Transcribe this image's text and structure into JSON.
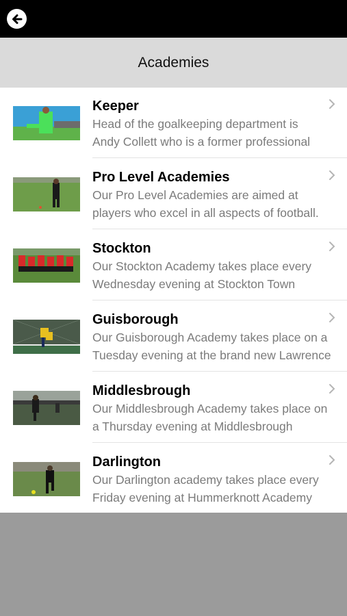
{
  "header": {
    "back_icon": "arrow-left-circle-icon",
    "title": "Academies"
  },
  "colors": {
    "topbar": "#000000",
    "titlebar": "#dadada",
    "list_bg": "#ffffff",
    "footer_bg": "#9b9b9b",
    "desc_text": "#7b7b7b"
  },
  "academies": [
    {
      "name": "Keeper",
      "line1": "Head of the goalkeeping department is",
      "line2": "Andy Collett who is a former professional",
      "thumb": "photo-goalkeeper-green-kit",
      "chevron_icon": "chevron-right-icon"
    },
    {
      "name": "Pro Level Academies",
      "line1": "Our Pro Level Academies are aimed at",
      "line2": "players who excel in all aspects of football.",
      "thumb": "photo-player-on-pitch",
      "chevron_icon": "chevron-right-icon"
    },
    {
      "name": "Stockton",
      "line1": "Our Stockton Academy takes place every",
      "line2": "Wednesday evening at Stockton Town",
      "thumb": "photo-team-red-kits",
      "chevron_icon": "chevron-right-icon"
    },
    {
      "name": "Guisborough",
      "line1": "Our Guisborough Academy takes place on a",
      "line2": "Tuesday evening at the brand new Lawrence",
      "thumb": "photo-players-yellow-kits",
      "chevron_icon": "chevron-right-icon"
    },
    {
      "name": "Middlesbrough",
      "line1": "Our Middlesbrough Academy takes place on",
      "line2": "a Thursday evening at Middlesbrough",
      "thumb": "photo-players-training",
      "chevron_icon": "chevron-right-icon"
    },
    {
      "name": "Darlington",
      "line1": "Our Darlington academy takes place every",
      "line2": "Friday evening at Hummerknott Academy",
      "thumb": "photo-player-black-kit",
      "chevron_icon": "chevron-right-icon"
    }
  ]
}
